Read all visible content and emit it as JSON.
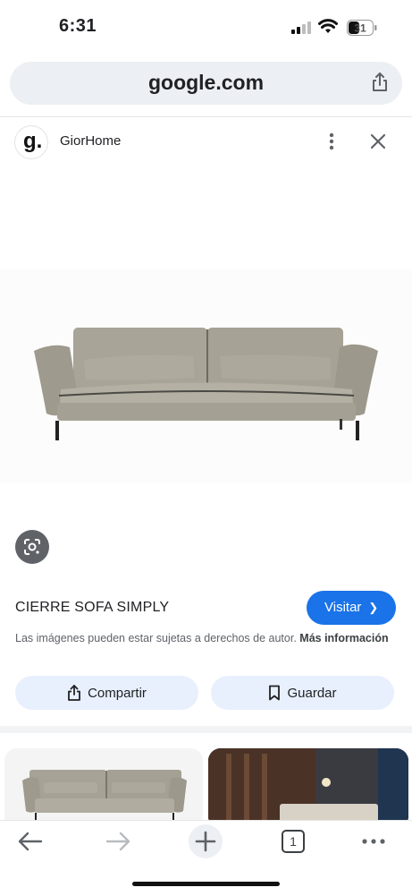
{
  "status_bar": {
    "time": "6:31",
    "battery_level": "31",
    "icons": [
      "signal-icon",
      "wifi-icon",
      "battery-icon"
    ]
  },
  "browser": {
    "url": "google.com",
    "share_icon": "share-icon"
  },
  "source": {
    "logo_letter": "g.",
    "name": "GiorHome",
    "icons": [
      "more-vert-icon",
      "close-icon"
    ]
  },
  "product": {
    "title": "CIERRE SOFA SIMPLY",
    "visit_label": "Visitar",
    "copyright_text": "Las imágenes pueden estar sujetas a derechos de autor.",
    "more_info_label": "Más información"
  },
  "actions": {
    "share_label": "Compartir",
    "save_label": "Guardar"
  },
  "toolbar": {
    "tab_count": "1",
    "icons": [
      "back-icon",
      "forward-icon",
      "new-tab-icon",
      "tabs-icon",
      "more-horiz-icon"
    ]
  },
  "colors": {
    "accent": "#1a73e8",
    "pill_bg": "#e8f0fe",
    "url_bar_bg": "#eceff3"
  }
}
